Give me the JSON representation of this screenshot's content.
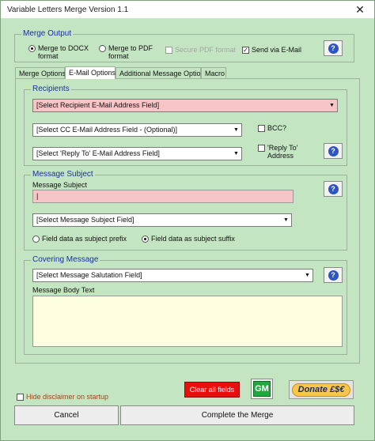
{
  "window": {
    "title": "Variable Letters Merge Version 1.1",
    "close_glyph": "✕"
  },
  "merge_output": {
    "label": "Merge Output",
    "docx_label": "Merge to DOCX format",
    "pdf_label": "Merge to PDF format",
    "secure_pdf_label": "Secure PDF format",
    "send_email_label": "Send via E-Mail",
    "selected": "docx",
    "send_email_checked": true
  },
  "tabs": [
    {
      "label": "Merge Options"
    },
    {
      "label": "E-Mail Options"
    },
    {
      "label": "Additional Message Options"
    },
    {
      "label": "Macro"
    }
  ],
  "active_tab": "E-Mail Options",
  "recipients": {
    "label": "Recipients",
    "recipient_field": "[Select Recipient E-Mail Address Field]",
    "cc_field": "[Select CC E-Mail Address Field - (Optional)]",
    "reply_to_field": "[Select 'Reply To' E-Mail Address Field]",
    "bcc_label": "BCC?",
    "reply_to_check_label": "'Reply To' Address"
  },
  "message_subject": {
    "label": "Message Subject",
    "input_label": "Message Subject",
    "input_value": "|",
    "subject_field": "[Select Message Subject Field]",
    "prefix_label": "Field data as subject prefix",
    "suffix_label": "Field data as subject suffix",
    "selected": "suffix"
  },
  "covering_message": {
    "label": "Covering Message",
    "salutation_field": "[Select Message Salutation Field]",
    "body_label": "Message Body Text",
    "body_value": ""
  },
  "footer": {
    "hide_disclaimer_label": "Hide disclaimer on startup",
    "clear_label": "Clear all fields",
    "gm_label": "GM",
    "donate_label": "Donate £$€",
    "cancel_label": "Cancel",
    "complete_label": "Complete the Merge"
  },
  "icons": {
    "help": "help-icon",
    "arrow": "dropdown-arrow-icon"
  },
  "colors": {
    "background": "#c4e5c2",
    "frame_label": "#1a2f9e",
    "required_field": "#f7c5c5",
    "body_box": "#fdfde0",
    "clear_button": "#e8100e",
    "gm_button": "#1fa83e",
    "donate_button": "#f7c64b"
  }
}
